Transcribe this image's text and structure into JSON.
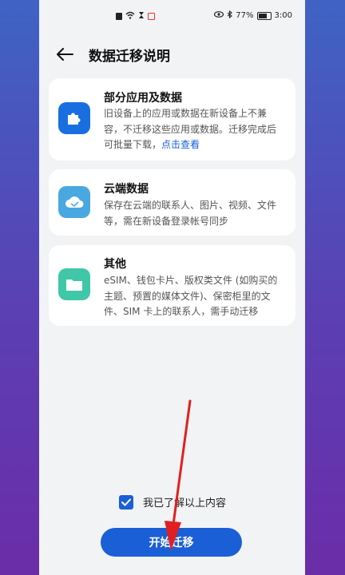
{
  "status_bar": {
    "battery_percent": "77%",
    "time": "3:00"
  },
  "header": {
    "title": "数据迁移说明",
    "back_icon": "arrow-left-icon"
  },
  "cards": [
    {
      "heading": "部分应用及数据",
      "desc": "旧设备上的应用或数据在新设备上不兼容，不迁移这些应用或数据。迁移完成后可批量下载，",
      "link": "点击查看",
      "icon": "puzzle-icon",
      "icon_color": "#1a6fe0"
    },
    {
      "heading": "云端数据",
      "desc": "保存在云端的联系人、图片、视频、文件等，需在新设备登录帐号同步",
      "icon": "cloud-icon",
      "icon_color": "#4aa8e0"
    },
    {
      "heading": "其他",
      "desc": "eSIM、钱包卡片、版权类文件 (如购买的主题、预置的媒体文件)、保密柜里的文件、SIM 卡上的联系人，需手动迁移",
      "icon": "folder-icon",
      "icon_color": "#3fc7a8"
    }
  ],
  "confirm": {
    "label": "我已了解以上内容",
    "checked": true
  },
  "start_button": {
    "label": "开始迁移"
  },
  "colors": {
    "accent": "#1a5fd6",
    "annotation_arrow": "#e02020"
  }
}
